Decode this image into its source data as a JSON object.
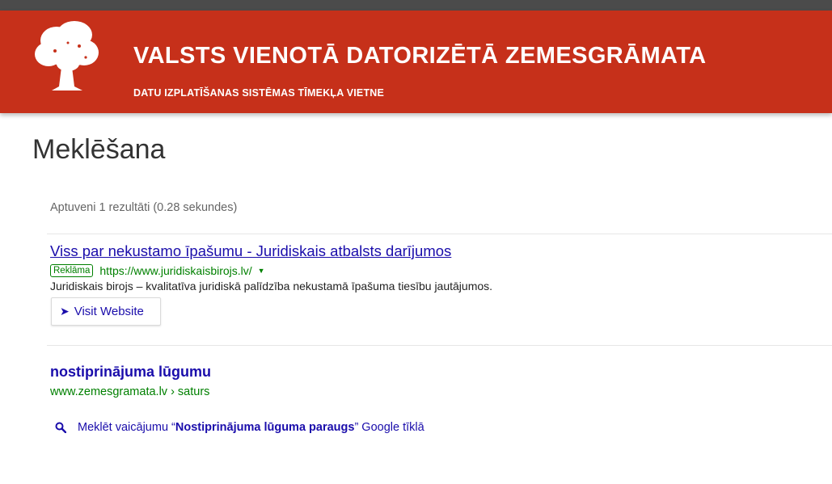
{
  "header": {
    "title": "VALSTS VIENOTĀ DATORIZĒTĀ ZEMESGRĀMATA",
    "subtitle": "DATU IZPLATĪŠANAS SISTĒMAS TĪMEKĻA VIETNE",
    "logo_icon": "tree-icon",
    "brand_color": "#c6301a"
  },
  "page": {
    "title": "Meklēšana"
  },
  "results": {
    "count_text": "Aptuveni 1 rezultāti (0.28 sekundes)",
    "ad": {
      "title": "Viss par nekustamo īpašumu - Juridiskais atbalsts darījumos",
      "badge": "Reklāma",
      "url": "https://www.juridiskaisbirojs.lv/",
      "arrow": "▼",
      "description": "Juridiskais birojs – kvalitatīva juridiskā palīdzība nekustamā īpašuma tiesību jautājumos.",
      "button_label": "Visit Website",
      "button_icon": "arrow-right-icon"
    },
    "items": [
      {
        "title": "nostiprinājuma lūgumu",
        "url": "www.zemesgramata.lv › saturs"
      }
    ],
    "search_hint": {
      "prefix": "Meklēt vaicājumu “",
      "query": "Nostiprinājuma lūguma paraugs",
      "suffix": "” Google tīklā",
      "icon": "search-icon"
    }
  }
}
